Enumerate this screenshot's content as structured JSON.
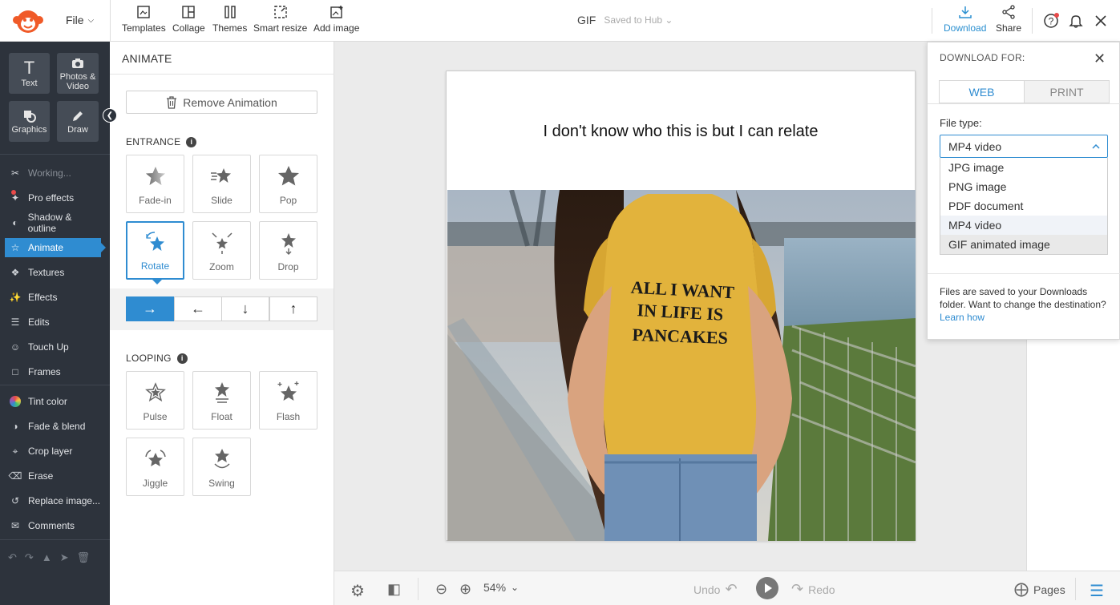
{
  "topbar": {
    "file_label": "File",
    "tools": [
      {
        "label": "Templates",
        "icon": "templates-icon"
      },
      {
        "label": "Collage",
        "icon": "collage-icon"
      },
      {
        "label": "Themes",
        "icon": "themes-icon"
      },
      {
        "label": "Smart resize",
        "icon": "smart-resize-icon"
      },
      {
        "label": "Add image",
        "icon": "add-image-icon"
      }
    ],
    "doc_title": "GIF",
    "doc_status": "Saved to Hub",
    "download_label": "Download",
    "share_label": "Share"
  },
  "leftnav": {
    "tiles": [
      {
        "label": "Text",
        "icon": "text-icon"
      },
      {
        "label": "Photos & Video",
        "icon": "camera-icon"
      },
      {
        "label": "Graphics",
        "icon": "graphics-icon"
      },
      {
        "label": "Draw",
        "icon": "draw-icon"
      }
    ],
    "items": [
      {
        "label": "Working...",
        "icon": "scissors-icon"
      },
      {
        "label": "Pro effects",
        "icon": "pro-effects-icon"
      },
      {
        "label": "Shadow & outline",
        "icon": "shadow-icon"
      },
      {
        "label": "Animate",
        "icon": "star-icon"
      },
      {
        "label": "Textures",
        "icon": "textures-icon"
      },
      {
        "label": "Effects",
        "icon": "effects-icon"
      },
      {
        "label": "Edits",
        "icon": "edits-icon"
      },
      {
        "label": "Touch Up",
        "icon": "touch-up-icon"
      },
      {
        "label": "Frames",
        "icon": "frames-icon"
      },
      {
        "label": "Tint color",
        "icon": "tint-icon"
      },
      {
        "label": "Fade & blend",
        "icon": "fade-icon"
      },
      {
        "label": "Crop layer",
        "icon": "crop-icon"
      },
      {
        "label": "Erase",
        "icon": "erase-icon"
      },
      {
        "label": "Replace image...",
        "icon": "replace-icon"
      },
      {
        "label": "Comments",
        "icon": "comments-icon"
      }
    ]
  },
  "animate": {
    "title": "ANIMATE",
    "remove_label": "Remove Animation",
    "entrance_label": "ENTRANCE",
    "entrance": [
      "Fade-in",
      "Slide",
      "Pop",
      "Rotate",
      "Zoom",
      "Drop"
    ],
    "selected": "Rotate",
    "directions": [
      "→",
      "←",
      "↓",
      "↑"
    ],
    "looping_label": "LOOPING",
    "looping": [
      "Pulse",
      "Float",
      "Flash",
      "Jiggle",
      "Swing"
    ]
  },
  "canvas": {
    "headline": "I don't know who this is but I can relate",
    "shirt_text": [
      "ALL I WANT",
      "IN LIFE IS",
      "PANCAKES"
    ]
  },
  "bottombar": {
    "zoom": "54%",
    "undo": "Undo",
    "redo": "Redo",
    "pages": "Pages"
  },
  "download_panel": {
    "title": "DOWNLOAD FOR:",
    "tabs": [
      "WEB",
      "PRINT"
    ],
    "active_tab": "WEB",
    "filetype_label": "File type:",
    "filetype_value": "MP4 video",
    "options": [
      "JPG image",
      "PNG image",
      "PDF document",
      "MP4 video",
      "GIF animated image"
    ],
    "note": "Files are saved to your Downloads folder. Want to change the destination?",
    "link": "Learn how"
  },
  "colors": {
    "accent": "#2f8cd1",
    "nav_bg": "#2d333c",
    "shirt": "#e2b33c"
  }
}
